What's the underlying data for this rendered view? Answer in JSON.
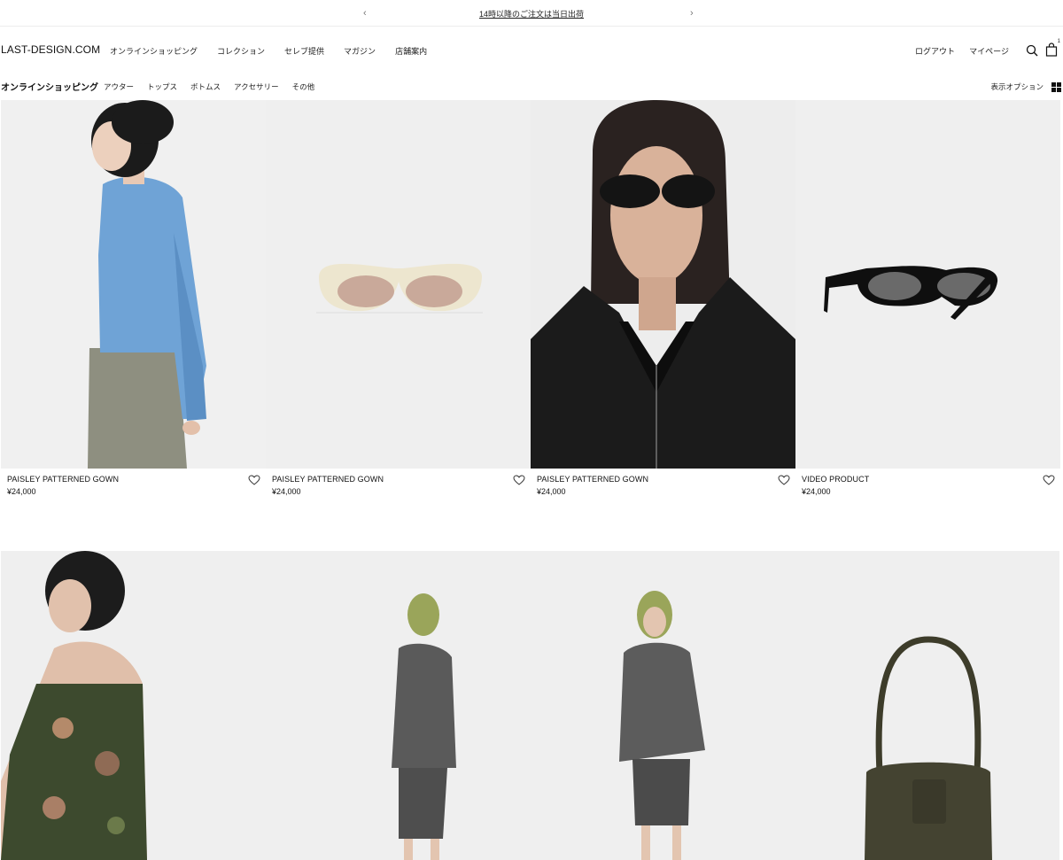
{
  "announcement": {
    "prev_arrow": "‹",
    "message": "14時以降のご注文は当日出荷",
    "next_arrow": "›"
  },
  "header": {
    "logo": "LAST-DESIGN.COM",
    "nav": [
      "オンラインショッピング",
      "コレクション",
      "セレブ提供",
      "マガジン",
      "店舗案内"
    ],
    "logout": "ログアウト",
    "mypage": "マイページ",
    "cart_count": "1"
  },
  "subnav": {
    "title": "オンラインショッピング",
    "categories": [
      "アウター",
      "トップス",
      "ボトムス",
      "アクセサリー",
      "その他"
    ],
    "display_options": "表示オプション"
  },
  "products": [
    {
      "name": "PAISLEY PATTERNED GOWN",
      "price": "¥24,000",
      "image": "model-blue-shirt"
    },
    {
      "name": "PAISLEY PATTERNED GOWN",
      "price": "¥24,000",
      "image": "cream-sunglasses"
    },
    {
      "name": "PAISLEY PATTERNED GOWN",
      "price": "¥24,000",
      "image": "model-black-jacket-sunglasses"
    },
    {
      "name": "VIDEO PRODUCT",
      "price": "¥24,000",
      "image": "black-sunglasses"
    }
  ],
  "second_row_images": [
    "model-floral-dress",
    "model-grey-suit-side",
    "model-grey-suit-front",
    "olive-shoulder-bag"
  ],
  "colors": {
    "text": "#111111",
    "image_bg": "#efefef",
    "divider": "#ececec"
  }
}
